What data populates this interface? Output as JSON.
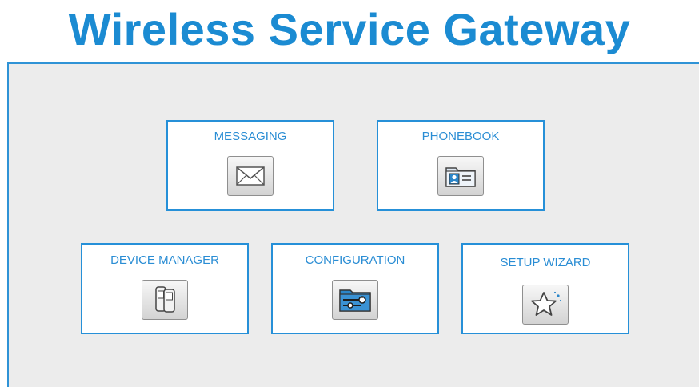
{
  "header": {
    "title": "Wireless Service Gateway"
  },
  "tiles": {
    "messaging": {
      "label": "MESSAGING",
      "icon": "envelope-icon"
    },
    "phonebook": {
      "label": "PHONEBOOK",
      "icon": "contact-card-icon"
    },
    "device_manager": {
      "label": "DEVICE MANAGER",
      "icon": "mobile-devices-icon"
    },
    "configuration": {
      "label": "CONFIGURATION",
      "icon": "folder-settings-icon"
    },
    "setup_wizard": {
      "label": "SETUP WIZARD",
      "icon": "star-wizard-icon"
    }
  },
  "colors": {
    "accent": "#1b8bd2",
    "panel_bg": "#ececec",
    "tile_border": "#2690d8"
  }
}
